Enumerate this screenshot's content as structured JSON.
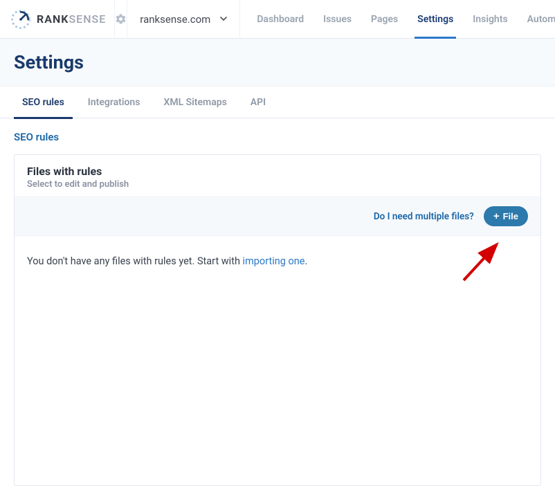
{
  "header": {
    "brand_strong": "RANK",
    "brand_light": "SENSE",
    "domain": "ranksense.com",
    "nav": [
      {
        "label": "Dashboard",
        "active": false
      },
      {
        "label": "Issues",
        "active": false
      },
      {
        "label": "Pages",
        "active": false
      },
      {
        "label": "Settings",
        "active": true
      },
      {
        "label": "Insights",
        "active": false
      },
      {
        "label": "Automation",
        "active": false
      }
    ]
  },
  "page": {
    "title": "Settings",
    "tabs": [
      {
        "label": "SEO rules",
        "active": true
      },
      {
        "label": "Integrations",
        "active": false
      },
      {
        "label": "XML Sitemaps",
        "active": false
      },
      {
        "label": "API",
        "active": false
      }
    ],
    "section_heading": "SEO rules"
  },
  "card": {
    "title": "Files with rules",
    "subtitle": "Select to edit and publish",
    "help_link": "Do I need multiple files?",
    "add_button": "File",
    "empty_prefix": "You don't have any files with rules yet. Start with ",
    "empty_link": "importing one",
    "empty_suffix": "."
  }
}
